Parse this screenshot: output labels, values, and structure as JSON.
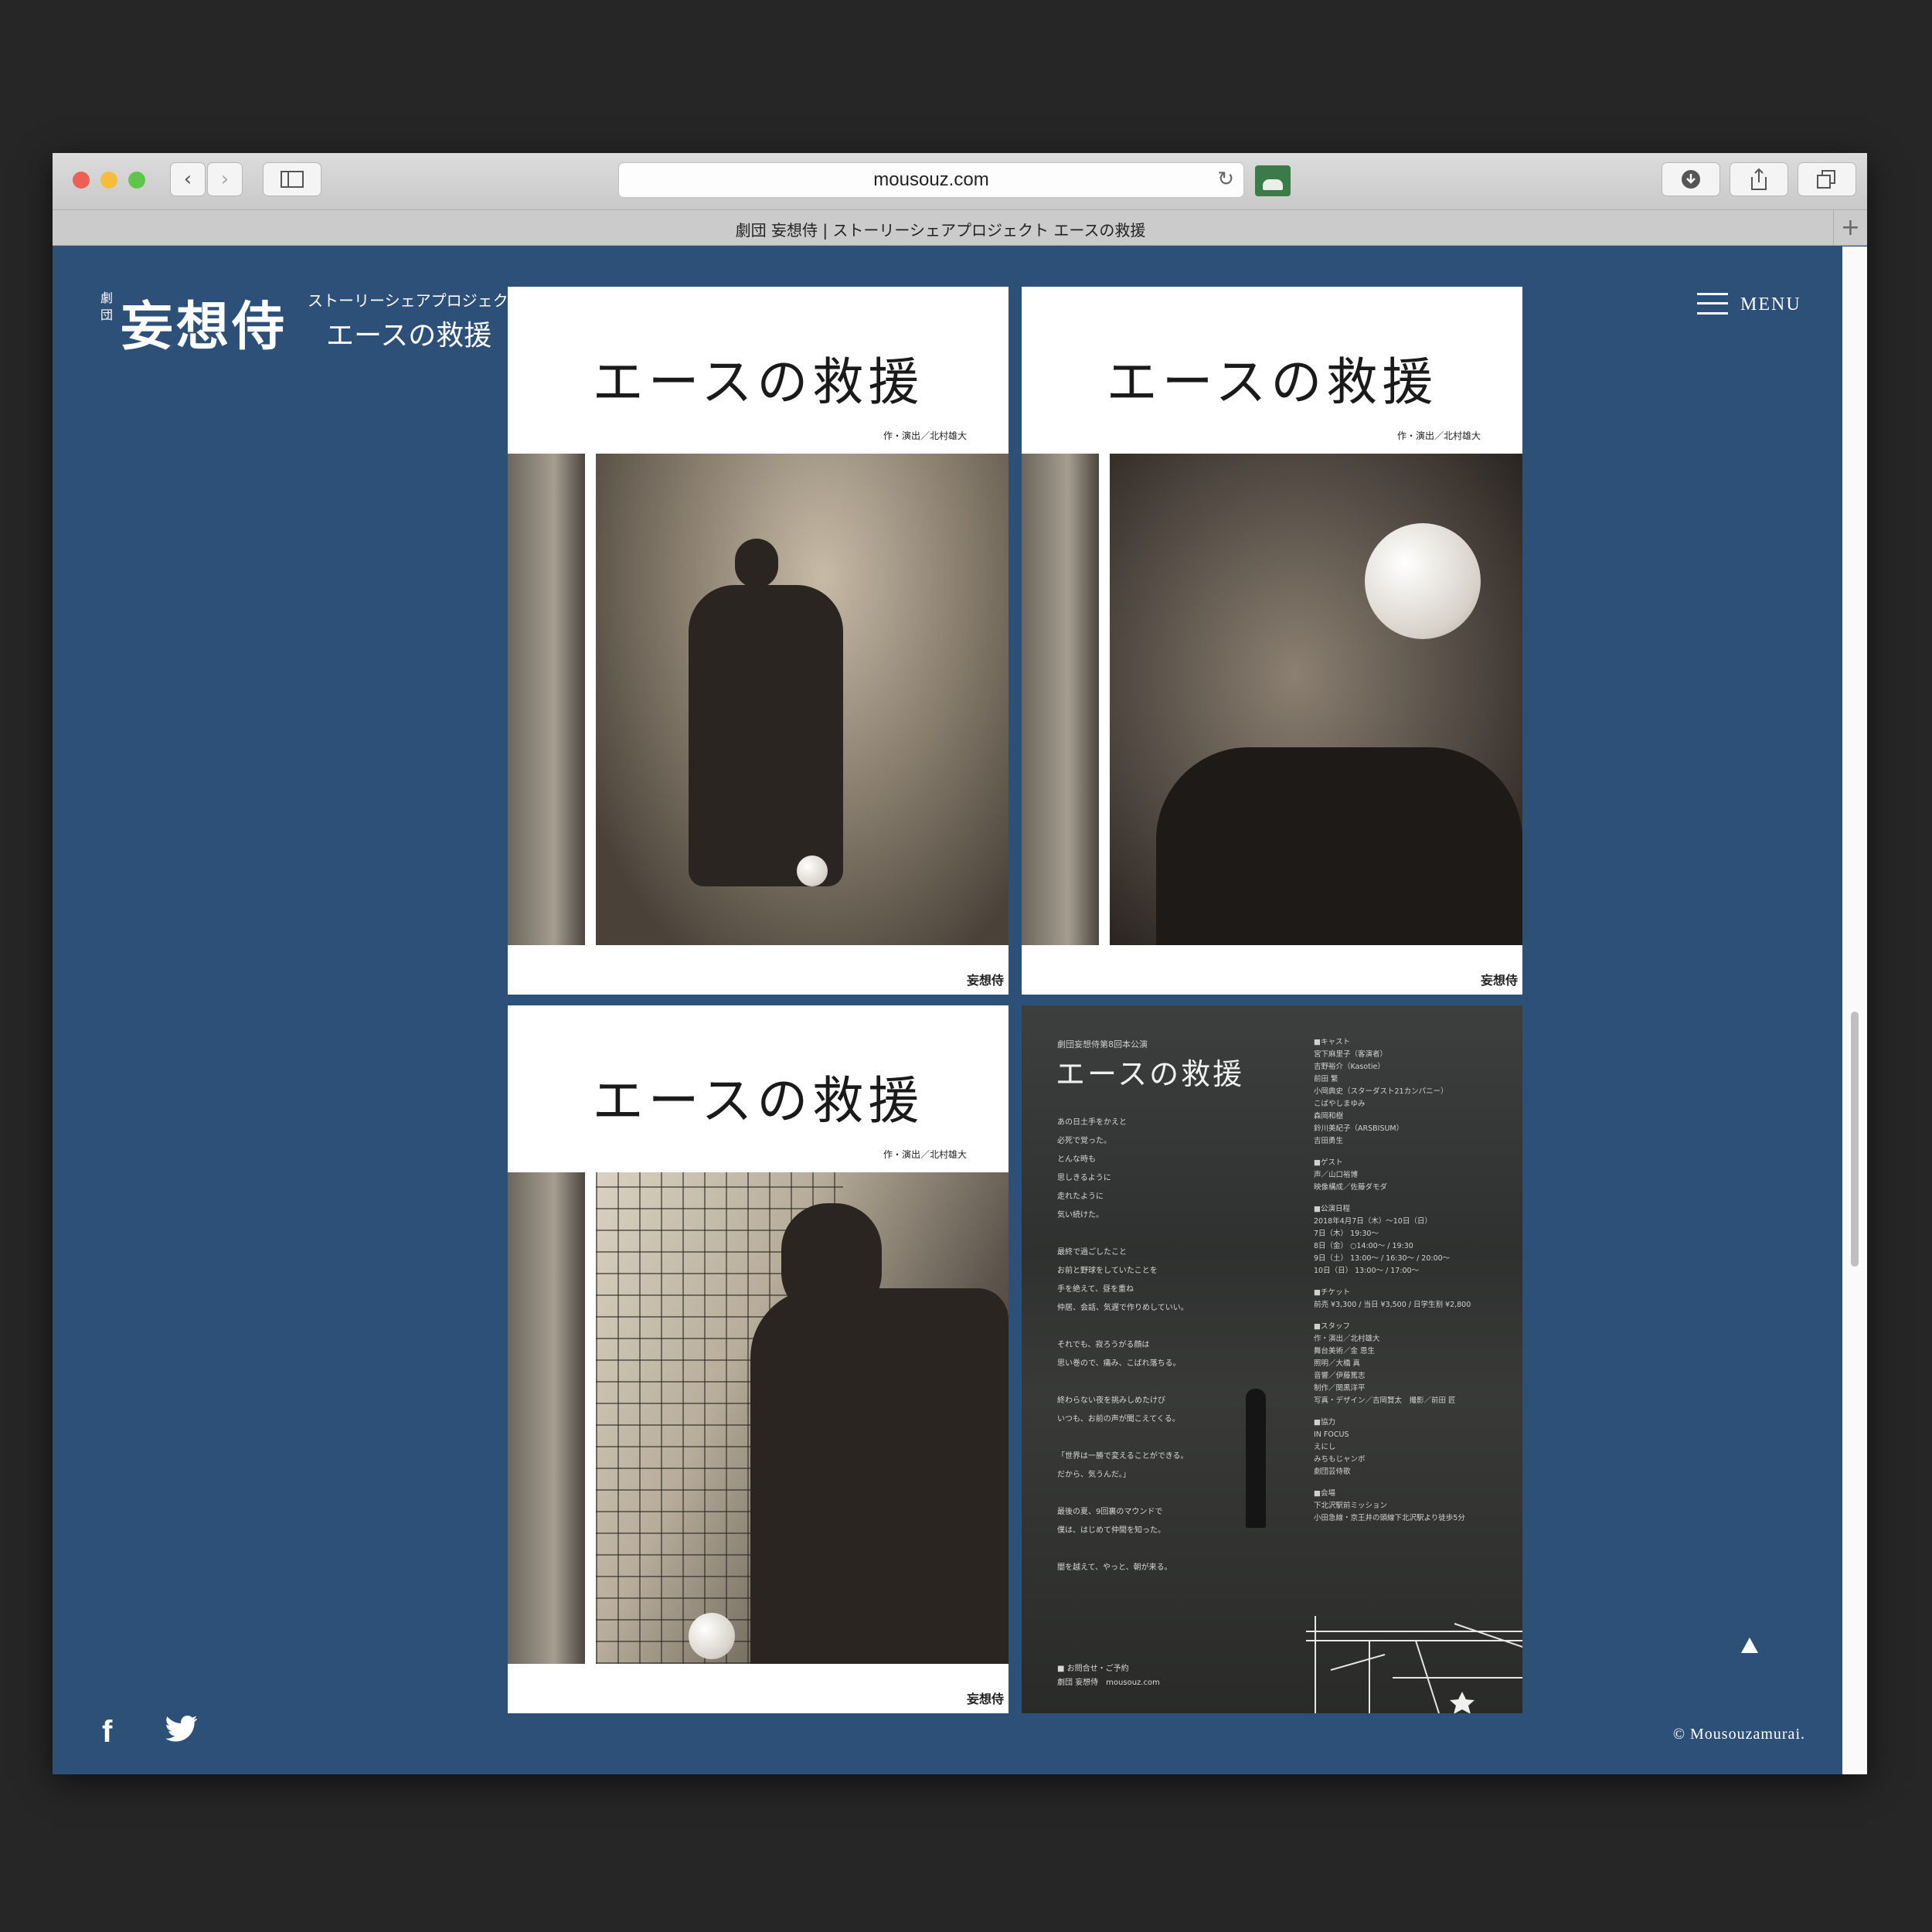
{
  "browser": {
    "url": "mousouz.com",
    "tab_title": "劇団 妄想侍 | ストーリーシェアプロジェクト エースの救援",
    "new_tab": "+",
    "back": "‹",
    "forward": "›",
    "reload": "↻"
  },
  "site": {
    "logo": {
      "small": "劇団",
      "main": "妄想侍",
      "subtitle": "ストーリーシェアプロジェクト",
      "title": "エースの救援"
    },
    "menu_label": "MENU",
    "social": {
      "facebook": "f",
      "twitter": "twitter-icon"
    },
    "copyright": "© Mousouzamurai.",
    "to_top": "back-to-top-icon",
    "colors": {
      "background": "#2d5078",
      "text": "#ffffff"
    }
  },
  "posters": [
    {
      "title": "エースの救援",
      "credit": "作・演出／北村雄大",
      "mark": "妄想侍"
    },
    {
      "title": "エースの救援",
      "credit": "作・演出／北村雄大",
      "mark": "妄想侍"
    },
    {
      "title": "エースの救援",
      "credit": "作・演出／北村雄大",
      "mark": "妄想侍"
    }
  ],
  "flyer": {
    "eyebrow": "劇団妄想侍第8回本公演",
    "title": "エースの救援",
    "copy": [
      [
        "あの日土手をかえと",
        "必死で覚った。",
        "とんな時も",
        "思しきるように",
        "走れたように",
        "気い続けた。"
      ],
      [
        "最終で過ごしたこと",
        "お前と野球をしていたことを",
        "手を絶えて、昼を重ね",
        "仲居、会話、気遅で作りめしていい。"
      ],
      [
        "それでも、寂ろうがる顔は",
        "思い巻ので、痛み、こばれ落ちる。"
      ],
      [
        "終わらない夜を挑みしめたけび",
        "いつも、お前の声が聞こえてくる。"
      ],
      [
        "「世界は一勝で変えることができる。",
        "だから、気うんだ。」"
      ],
      [
        "最後の夏、9回裏のマウンドで",
        "僕は、はじめて仲間を知った。"
      ],
      [
        "闇を越えて、やっと、朝が来る。"
      ]
    ],
    "info": [
      [
        "■キャスト",
        "宮下麻里子（客演者）",
        "吉野裕介（Kasotie）",
        "前田 繁",
        "小岡典史（スターダスト21カンパニー）",
        "こばやしまゆみ",
        "森岡和樹",
        "鈴川美紀子（ARSBISUM）",
        "吉田勇生"
      ],
      [
        "■ゲスト",
        "声／山口裕博",
        "映像構成／佐藤ダモダ"
      ],
      [
        "■公演日程",
        "2018年4月7日（木）〜10日（日）",
        "7日（木） 19:30〜",
        "8日（金） ○14:00〜 / 19:30",
        "9日（土） 13:00〜 / 16:30〜 / 20:00〜",
        "10日（日） 13:00〜 / 17:00〜"
      ],
      [
        "■チケット",
        "前売 ¥3,300 / 当日 ¥3,500 / 日学生割 ¥2,800"
      ],
      [
        "■スタッフ",
        "作・演出／北村雄大",
        "舞台美術／金 恩生",
        "照明／大橋 真",
        "音響／伊藤篤志",
        "制作／関黒洋平",
        "写真・デザイン／吉岡賢太　撮影／前田 匠"
      ],
      [
        "■協力",
        "IN FOCUS",
        "えにし",
        "みちもじャンボ",
        "劇団芸侍歌"
      ],
      [
        "■会場",
        "下北沢駅前ミッション",
        "小田急線・京王井の頭線下北沢駅より徒歩5分"
      ]
    ],
    "footer": [
      "■ お問合せ・ご予約",
      "劇団 妄想侍　mousouz.com"
    ]
  }
}
